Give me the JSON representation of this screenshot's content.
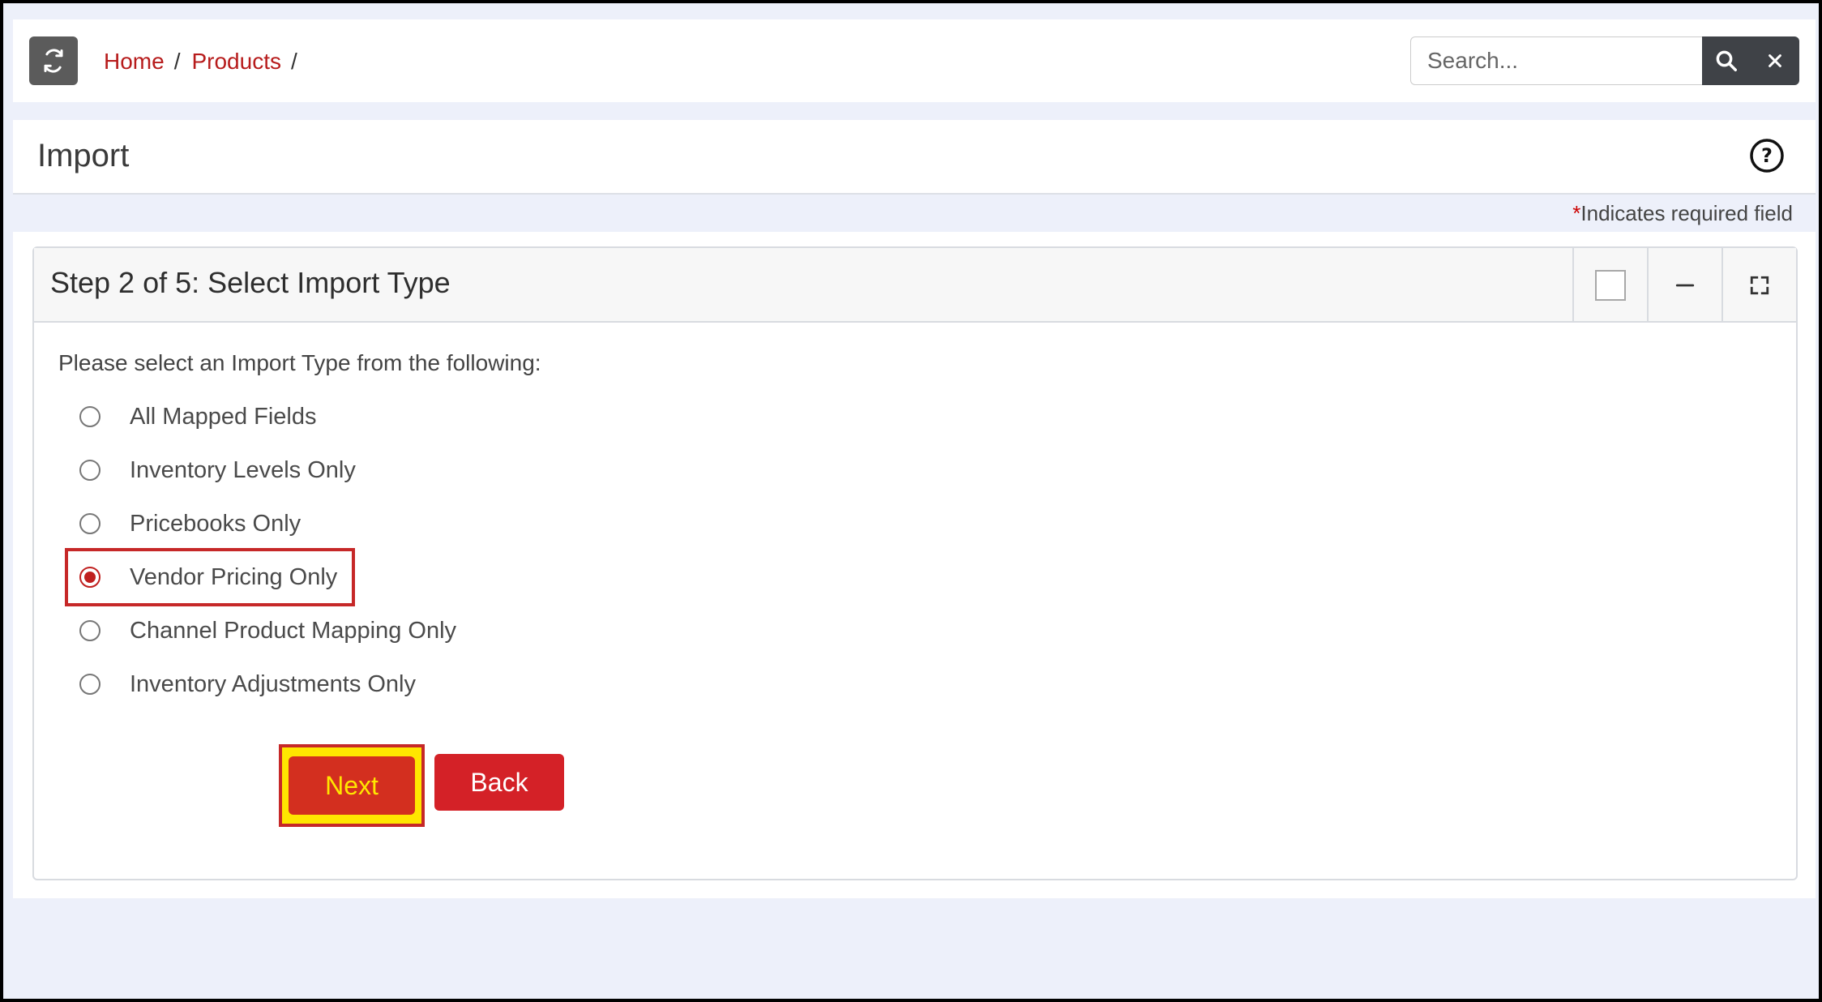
{
  "breadcrumb": {
    "items": [
      {
        "label": "Home"
      },
      {
        "label": "Products"
      }
    ],
    "separator": "/"
  },
  "search": {
    "placeholder": "Search...",
    "value": ""
  },
  "page": {
    "title": "Import",
    "required_star": "*",
    "required_note": "Indicates required field"
  },
  "panel": {
    "title": "Step 2 of 5: Select Import Type",
    "intro": "Please select an Import Type from the following:",
    "options": [
      {
        "label": "All Mapped Fields",
        "checked": false
      },
      {
        "label": "Inventory Levels Only",
        "checked": false
      },
      {
        "label": "Pricebooks Only",
        "checked": false
      },
      {
        "label": "Vendor Pricing Only",
        "checked": true
      },
      {
        "label": "Channel Product Mapping Only",
        "checked": false
      },
      {
        "label": "Inventory Adjustments Only",
        "checked": false
      }
    ],
    "next_label": "Next",
    "back_label": "Back"
  },
  "icons": {
    "refresh": "refresh-icon",
    "search": "search-icon",
    "clear": "close-icon",
    "help": "help-circle-icon",
    "minimize": "minus-icon",
    "fullscreen": "expand-icon"
  },
  "colors": {
    "accent": "#b71c1c",
    "button": "#d42127",
    "highlight": "#ffe600",
    "background": "#edf0fa"
  }
}
